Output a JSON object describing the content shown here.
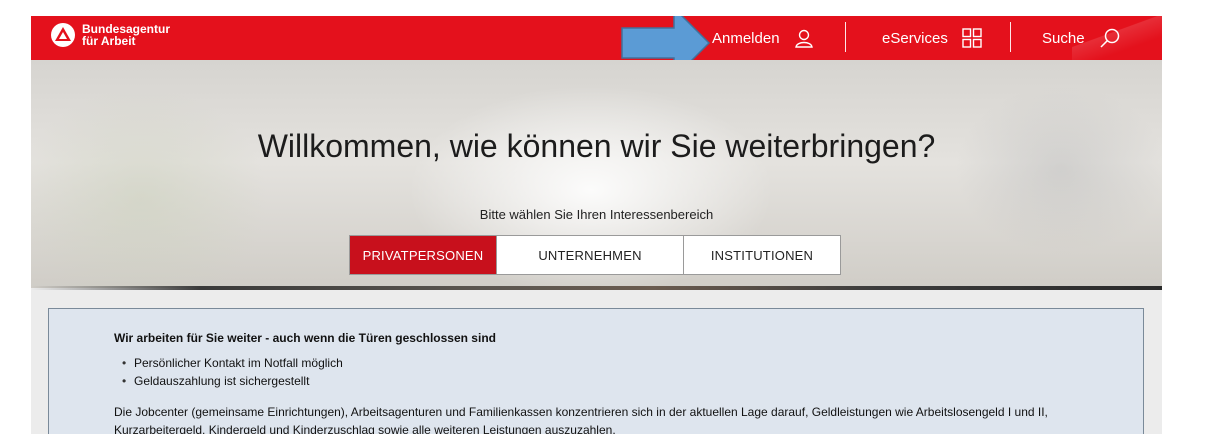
{
  "header": {
    "logo_line1": "Bundesagentur",
    "logo_line2": "für Arbeit",
    "nav": {
      "login_label": "Anmelden",
      "eservices_label": "eServices",
      "search_label": "Suche"
    },
    "icons": [
      "user-icon",
      "grid-icon",
      "search-icon"
    ],
    "brand_color": "#e4111c"
  },
  "hero": {
    "title": "Willkommen, wie können wir Sie weiterbringen?",
    "subtitle": "Bitte wählen Sie Ihren Interessenbereich",
    "tabs": [
      {
        "label": "PRIVATPERSONEN",
        "active": true
      },
      {
        "label": "UNTERNEHMEN",
        "active": false
      },
      {
        "label": "INSTITUTIONEN",
        "active": false
      }
    ],
    "active_color": "#c8101c"
  },
  "notice": {
    "title": "Wir arbeiten für Sie weiter - auch wenn die Türen geschlossen sind",
    "bullets": [
      "Persönlicher Kontakt im Notfall möglich",
      "Geldauszahlung ist sichergestellt"
    ],
    "body": "Die Jobcenter (gemeinsame Einrichtungen), Arbeitsagenturen und Familienkassen konzentrieren sich in der aktuellen Lage darauf, Geldleistungen wie Arbeitslosengeld I und II, Kurzarbeitergeld, Kindergeld und Kinderzuschlag sowie alle weiteren Leistungen auszuzahlen.",
    "background": "#dee5ee"
  }
}
